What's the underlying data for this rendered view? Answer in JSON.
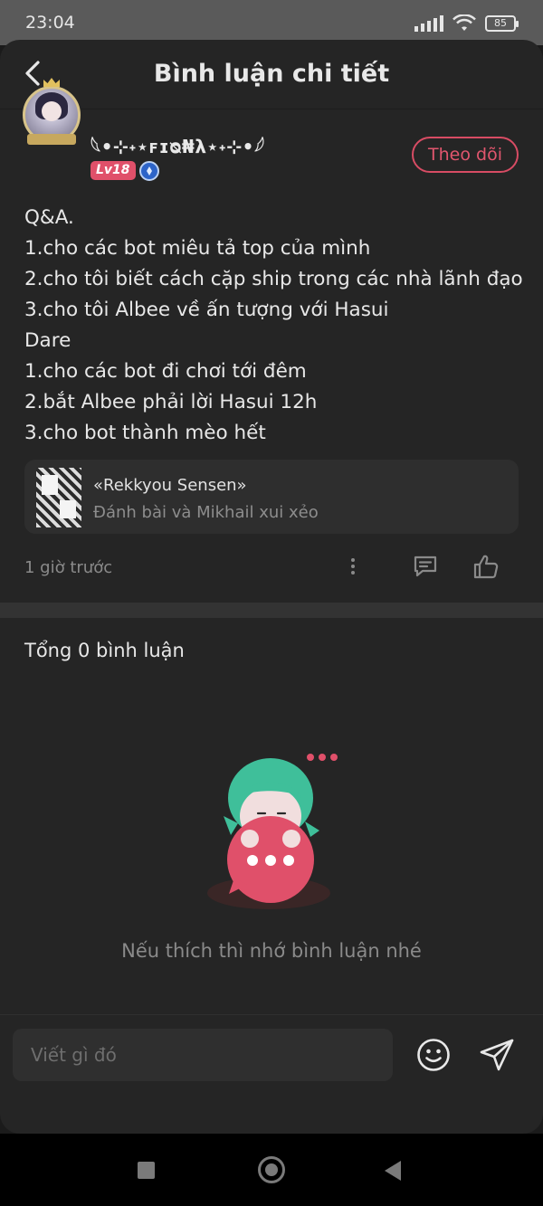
{
  "status_bar": {
    "time": "23:04",
    "battery": "85"
  },
  "header": {
    "title": "Bình luận chi tiết"
  },
  "post": {
    "author": {
      "name": "𓆩•⊹˖⋆ꜰɪᴓ₦λ⋆˖⊹•𓆪",
      "level": "Lv18"
    },
    "follow_label": "Theo dõi",
    "body": "Q&A.\n1.cho các bot miêu tả top của mình\n2.cho tôi biết cách cặp ship trong các nhà lãnh đạo\n3.cho tôi Albee về ấn tượng với Hasui\nDare\n1.cho các bot đi chơi tới đêm\n2.bắt Albee phải lời Hasui 12h\n3.cho bot thành mèo hết",
    "linked_story": {
      "title": "«Rekkyou Sensen»",
      "subtitle": "Đánh bài và Mikhail xui xẻo"
    },
    "time_ago": "1 giờ trước"
  },
  "comments": {
    "total_label": "Tổng 0 bình luận",
    "empty_message": "Nếu thích thì nhớ bình luận nhé"
  },
  "input": {
    "placeholder": "Viết gì đó"
  },
  "colors": {
    "accent": "#e0506a",
    "background": "#252525",
    "card": "#2e2e2e",
    "muted_text": "#8a8a8a"
  }
}
